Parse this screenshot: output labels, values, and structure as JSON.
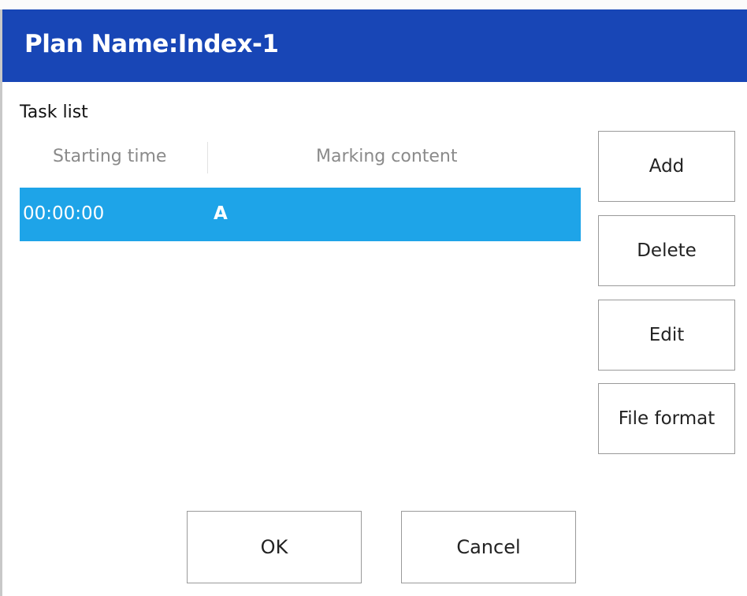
{
  "dialog": {
    "title": "Plan Name:Index-1"
  },
  "task_list": {
    "label": "Task list",
    "columns": [
      "Starting time",
      "Marking content"
    ],
    "rows": [
      {
        "starting_time": "00:00:00",
        "marking_content": "A",
        "selected": true
      }
    ]
  },
  "side_buttons": {
    "add": "Add",
    "delete": "Delete",
    "edit": "Edit",
    "file_format": "File format"
  },
  "footer_buttons": {
    "ok": "OK",
    "cancel": "Cancel"
  },
  "colors": {
    "titlebar": "#1846b6",
    "selected_row": "#1ea4e8"
  }
}
